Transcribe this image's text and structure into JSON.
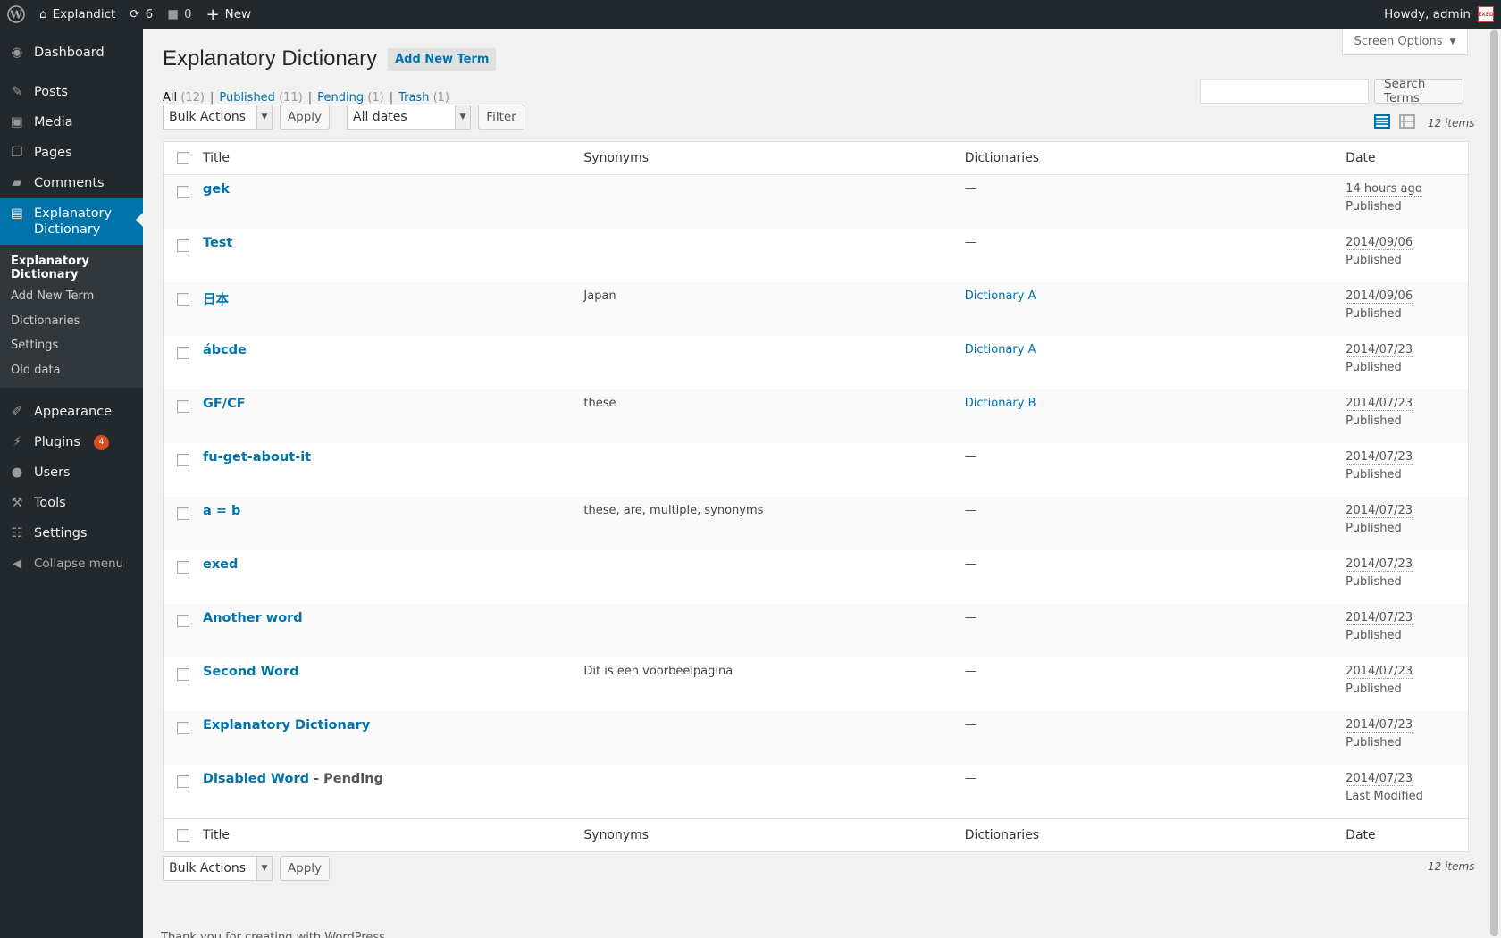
{
  "adminbar": {
    "site_name": "Explandict",
    "updates_count": "6",
    "comments_count": "0",
    "new_label": "New",
    "howdy": "Howdy, admin",
    "avatar_text": "EXED"
  },
  "sidebar": {
    "items": [
      {
        "label": "Dashboard",
        "icon": "dashboard-icon"
      },
      {
        "label": "Posts",
        "icon": "pin-icon"
      },
      {
        "label": "Media",
        "icon": "media-icon"
      },
      {
        "label": "Pages",
        "icon": "pages-icon"
      },
      {
        "label": "Comments",
        "icon": "comment-icon"
      },
      {
        "label": "Explanatory Dictionary",
        "icon": "book-icon"
      },
      {
        "label": "Appearance",
        "icon": "brush-icon"
      },
      {
        "label": "Plugins",
        "icon": "plug-icon",
        "badge": "4"
      },
      {
        "label": "Users",
        "icon": "user-icon"
      },
      {
        "label": "Tools",
        "icon": "wrench-icon"
      },
      {
        "label": "Settings",
        "icon": "settings-icon"
      }
    ],
    "submenu": [
      "Explanatory Dictionary",
      "Add New Term",
      "Dictionaries",
      "Settings",
      "Old data"
    ],
    "collapse": "Collapse menu"
  },
  "screen_options": "Screen Options",
  "page": {
    "title": "Explanatory Dictionary",
    "add_new": "Add New Term"
  },
  "filters": {
    "all": "All",
    "all_count": "(12)",
    "published": "Published",
    "published_count": "(11)",
    "pending": "Pending",
    "pending_count": "(1)",
    "trash": "Trash",
    "trash_count": "(1)",
    "sep": "|"
  },
  "search": {
    "button": "Search Terms",
    "value": ""
  },
  "tablenav": {
    "bulk_actions": "Bulk Actions",
    "apply": "Apply",
    "dates": "All dates",
    "filter": "Filter",
    "items": "12 items"
  },
  "columns": {
    "title": "Title",
    "synonyms": "Synonyms",
    "dictionaries": "Dictionaries",
    "date": "Date"
  },
  "rows": [
    {
      "title": "gek",
      "state": "",
      "synonyms": "",
      "dictionaries": "—",
      "date": "14 hours ago",
      "status": "Published"
    },
    {
      "title": "Test",
      "state": "",
      "synonyms": "",
      "dictionaries": "—",
      "date": "2014/09/06",
      "status": "Published"
    },
    {
      "title": "日本",
      "state": "",
      "synonyms": "Japan",
      "dictionaries": "Dictionary A",
      "date": "2014/09/06",
      "status": "Published"
    },
    {
      "title": "ábcde",
      "state": "",
      "synonyms": "",
      "dictionaries": "Dictionary A",
      "date": "2014/07/23",
      "status": "Published"
    },
    {
      "title": "GF/CF",
      "state": "",
      "synonyms": "these",
      "dictionaries": "Dictionary B",
      "date": "2014/07/23",
      "status": "Published"
    },
    {
      "title": "fu-get-about-it",
      "state": "",
      "synonyms": "",
      "dictionaries": "—",
      "date": "2014/07/23",
      "status": "Published"
    },
    {
      "title": "a = b",
      "state": "",
      "synonyms": "these, are, multiple, synonyms",
      "dictionaries": "—",
      "date": "2014/07/23",
      "status": "Published"
    },
    {
      "title": "exed",
      "state": "",
      "synonyms": "",
      "dictionaries": "—",
      "date": "2014/07/23",
      "status": "Published"
    },
    {
      "title": "Another word",
      "state": "",
      "synonyms": "",
      "dictionaries": "—",
      "date": "2014/07/23",
      "status": "Published"
    },
    {
      "title": "Second Word",
      "state": "",
      "synonyms": "Dit is een voorbeelpagina",
      "dictionaries": "—",
      "date": "2014/07/23",
      "status": "Published"
    },
    {
      "title": "Explanatory Dictionary",
      "state": "",
      "synonyms": "",
      "dictionaries": "—",
      "date": "2014/07/23",
      "status": "Published"
    },
    {
      "title": "Disabled Word",
      "state": " - Pending",
      "synonyms": "",
      "dictionaries": "—",
      "date": "2014/07/23",
      "status": "Last Modified"
    }
  ],
  "footer": "Thank you for creating with WordPress."
}
